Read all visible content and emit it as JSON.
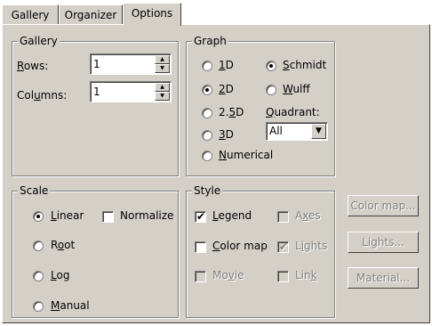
{
  "tabs": [
    {
      "label": "Gallery"
    },
    {
      "label": "Organizer"
    },
    {
      "label": "Options",
      "active": true
    }
  ],
  "gallery": {
    "title": "Gallery",
    "rows_label": "Rows:",
    "rows_value": "1",
    "columns_label": "Columns:",
    "columns_value": "1"
  },
  "graph": {
    "title": "Graph",
    "options": [
      "1D",
      "2D",
      "2.5D",
      "3D",
      "Numerical"
    ],
    "selected": "2D",
    "projection": [
      "Schmidt",
      "Wulff"
    ],
    "projection_selected": "Schmidt",
    "quadrant_label": "Quadrant:",
    "quadrant_value": "All"
  },
  "scale": {
    "title": "Scale",
    "options": [
      "Linear",
      "Root",
      "Log",
      "Manual"
    ],
    "selected": "Linear",
    "normalize_label": "Normalize",
    "normalize_checked": false
  },
  "style": {
    "title": "Style",
    "legend": {
      "label": "Legend",
      "checked": true
    },
    "color_map": {
      "label": "Color map",
      "checked": false
    },
    "movie": {
      "label": "Movie",
      "checked": false
    },
    "axes": {
      "label": "Axes",
      "checked": false
    },
    "lights": {
      "label": "Lights",
      "checked": true
    },
    "link": {
      "label": "Link",
      "checked": false
    }
  },
  "buttons": {
    "color_map": "Color map...",
    "lights": "Lights...",
    "material": "Material..."
  },
  "icons": {
    "spin_up": "spin-up-arrow-icon",
    "spin_down": "spin-down-arrow-icon",
    "dropdown": "dropdown-arrow-icon",
    "check": "checkmark-icon"
  }
}
